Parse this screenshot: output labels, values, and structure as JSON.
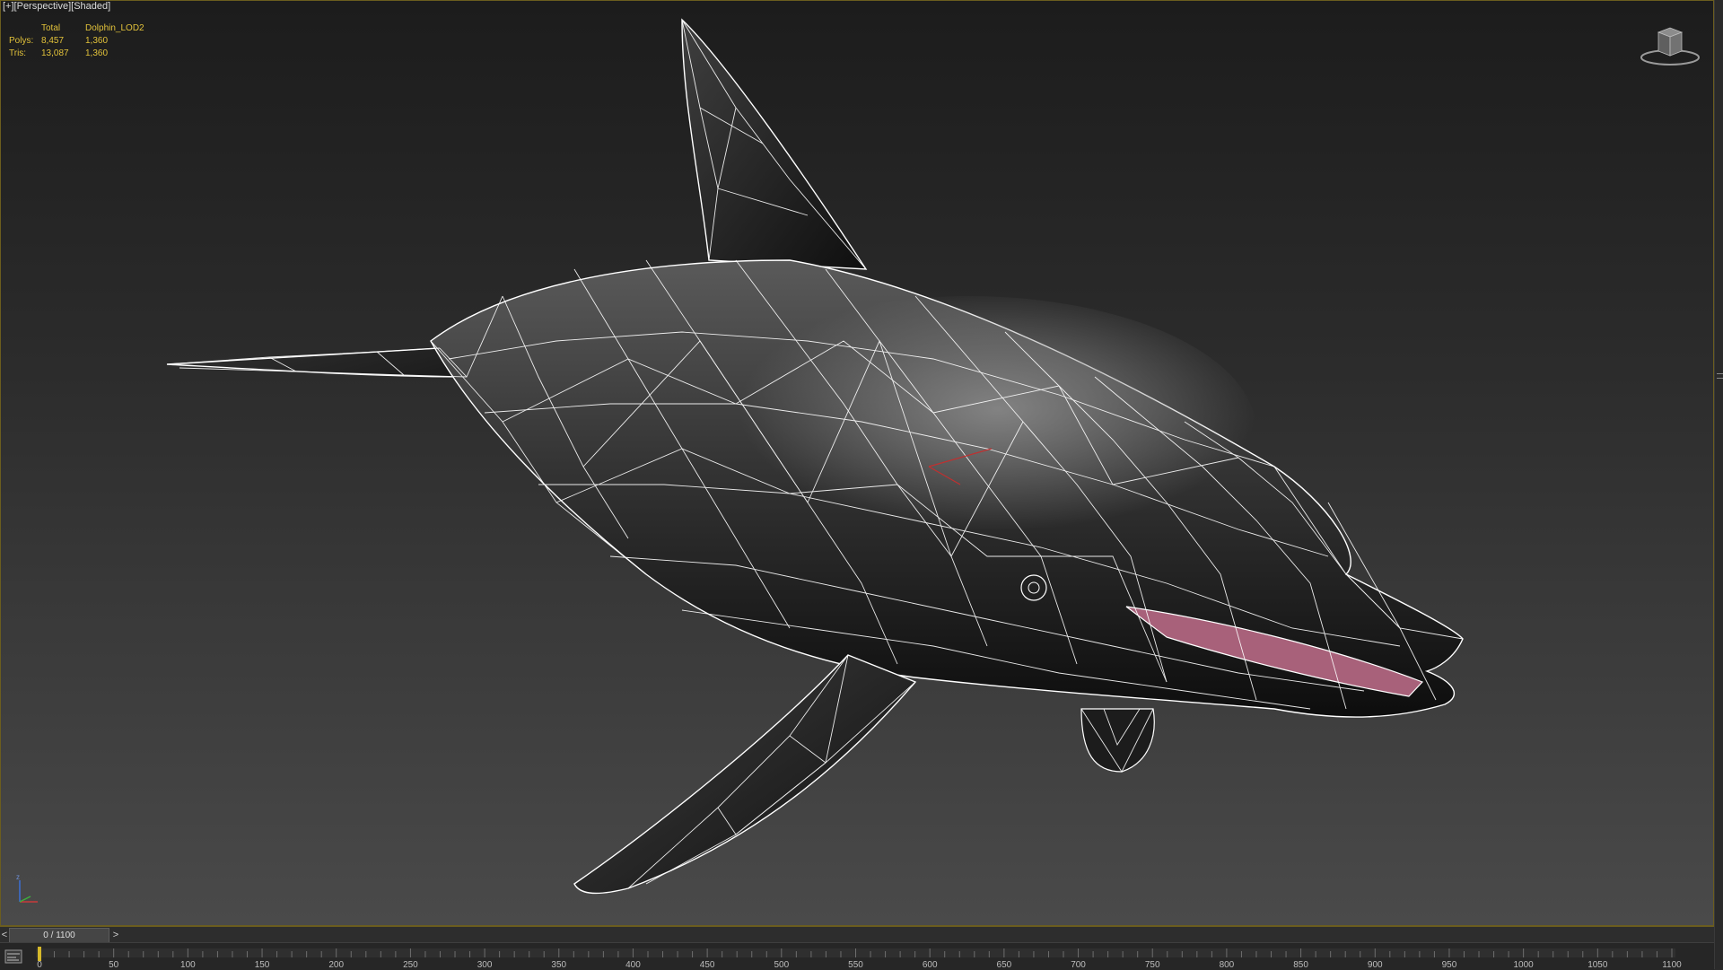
{
  "viewport": {
    "labels": [
      "[+]",
      "[Perspective]",
      "[Shaded]"
    ],
    "stats": {
      "header": [
        "",
        "Total",
        "Dolphin_LOD2"
      ],
      "rows": [
        {
          "label": "Polys:",
          "total": "8,457",
          "selected": "1,360"
        },
        {
          "label": "Tris:",
          "total": "13,087",
          "selected": "1,360"
        }
      ]
    },
    "viewcube_icon": "viewcube-icon",
    "axis_icon": "axis-tripod-icon",
    "axis_label": "z"
  },
  "time_slider": {
    "prev": "<",
    "value": "0 / 1100",
    "next": ">"
  },
  "track_bar": {
    "toggle_icon": "curve-editor-icon",
    "ticks": [
      "0",
      "50",
      "100",
      "150",
      "200",
      "250",
      "300",
      "350",
      "400",
      "450",
      "500",
      "550",
      "600",
      "650",
      "700",
      "750",
      "800",
      "850",
      "900",
      "950",
      "1000",
      "1050",
      "1100"
    ]
  },
  "colors": {
    "stats_text": "#e2c23a",
    "frame_border": "#6b5d1e",
    "wire": "#ffffff",
    "mouth": "#a8617a"
  }
}
